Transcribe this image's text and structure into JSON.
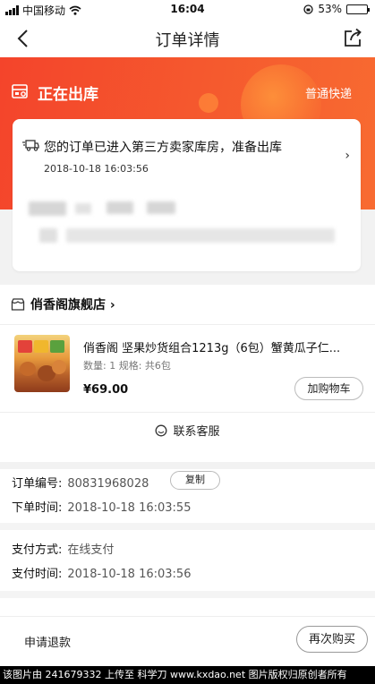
{
  "status_bar": {
    "carrier": "中国移动",
    "time": "16:04",
    "battery": "53%",
    "battery_level": 0.53
  },
  "nav": {
    "title": "订单详情"
  },
  "header": {
    "status_title": "正在出库",
    "shipping_type": "普通快递"
  },
  "logistics": {
    "message": "您的订单已进入第三方卖家库房，准备出库",
    "time": "2018-10-18 16:03:56",
    "chevron": "›"
  },
  "store": {
    "name": "俏香阁旗舰店 ›",
    "product": {
      "name": "俏香阁 坚果炒货组合1213g（6包）蟹黄瓜子仁...",
      "spec": "数量: 1 规格: 共6包",
      "price": "¥69.00",
      "cart_button": "加购物车"
    },
    "customer_service": "联系客服"
  },
  "order_info": {
    "order_no_label": "订单编号:",
    "order_no": "80831968028",
    "copy_button": "复制",
    "order_time_label": "下单时间:",
    "order_time": "2018-10-18 16:03:55",
    "pay_method_label": "支付方式:",
    "pay_method": "在线支付",
    "pay_time_label": "支付时间:",
    "pay_time": "2018-10-18 16:03:56"
  },
  "bottom_bar": {
    "refund": "申请退款",
    "rebuy": "再次购买"
  },
  "watermark": "该图片由 241679332 上传至 科学刀 www.kxdao.net 图片版权归原创者所有",
  "colors": {
    "accent": "#f4442b",
    "accent_end": "#f86b31"
  },
  "icons": [
    "signal-icon",
    "wifi-icon",
    "lock-rotation-icon",
    "battery-icon",
    "back-icon",
    "share-icon",
    "warehouse-icon",
    "truck-icon",
    "store-icon",
    "customer-service-icon"
  ]
}
